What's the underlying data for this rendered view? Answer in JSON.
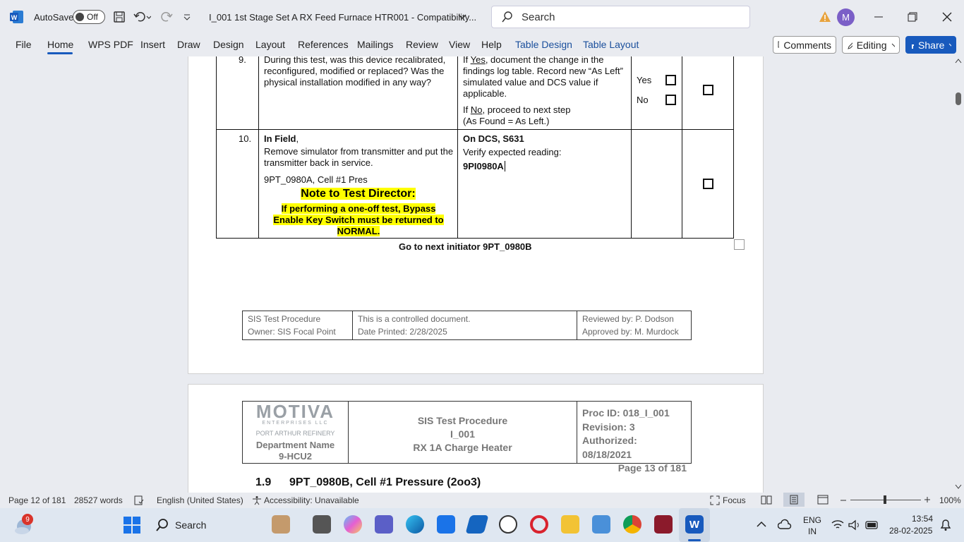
{
  "titlebar": {
    "autosave_label": "AutoSave",
    "autosave_state": "Off",
    "doc_title": "I_001 1st Stage Set A RX Feed Furnace HTR001  -  Compatibility...",
    "search_placeholder": "Search",
    "avatar_initial": "M"
  },
  "ribbon": {
    "tabs": [
      "File",
      "Home",
      "WPS PDF",
      "Insert",
      "Draw",
      "Design",
      "Layout",
      "References",
      "Mailings",
      "Review",
      "View",
      "Help",
      "Table Design",
      "Table Layout"
    ],
    "comments_label": "Comments",
    "editing_label": "Editing",
    "share_label": "Share"
  },
  "table": {
    "row9": {
      "num": "9.",
      "desc": "During this test, was this device recalibrated, reconfigured, modified or replaced? Was the physical installation modified in any way?",
      "instr1_pre": "If ",
      "instr1_link": "Yes",
      "instr1_post": ", document the change in the findings log table. Record new “As Left” simulated value and DCS value if applicable.",
      "instr2_pre": "If ",
      "instr2_link": "No",
      "instr2_post": ", proceed to next step",
      "instr3": "(As Found = As Left.)",
      "yes": "Yes",
      "no": "No"
    },
    "row10": {
      "num": "10.",
      "desc_title": "In Field",
      "desc_comma": ",",
      "desc": "Remove simulator from transmitter and put the transmitter back in service.",
      "tag": "9PT_0980A, Cell #1 Pres",
      "note_title": "Note to Test Director:",
      "note_body": "If performing a one-off test, Bypass Enable Key Switch must be returned to NORMAL.",
      "dcs_title": "On DCS, S631",
      "dcs_verify": "Verify expected reading:",
      "dcs_tag": "9PI0980A"
    }
  },
  "goto_next": "Go to next initiator 9PT_0980B",
  "footer": {
    "c1a": "SIS Test Procedure",
    "c1b": "Owner: SIS Focal Point",
    "c2a": "This is a controlled document.",
    "c2b": "Date Printed: 2/28/2025",
    "c3a": "Reviewed by: P. Dodson",
    "c3b": "Approved by: M. Murdock"
  },
  "header": {
    "logo": "MOTIVA",
    "logo_sub": "ENTERPRISES LLC",
    "refinery": "PORT ARTHUR REFINERY",
    "dept": "Department Name",
    "dept_val": "9-HCU2",
    "proc_title": "SIS Test Procedure",
    "proc_id_line": "I_001",
    "proc_name": "RX 1A Charge Heater",
    "proc_id": "Proc ID: 018_I_001",
    "revision": "Revision: 3",
    "authorized": "Authorized: 08/18/2021",
    "page": "Page 13 of 181"
  },
  "section": {
    "num": "1.9",
    "title": "9PT_0980B, Cell #1 Pressure (2oo3)"
  },
  "statusbar": {
    "page": "Page 12 of 181",
    "words": "28527 words",
    "language": "English (United States)",
    "accessibility": "Accessibility: Unavailable",
    "focus": "Focus",
    "zoom": "100%"
  },
  "taskbar": {
    "search": "Search",
    "badge": "9",
    "lang1": "ENG",
    "lang2": "IN",
    "time": "13:54",
    "date": "28-02-2025"
  }
}
